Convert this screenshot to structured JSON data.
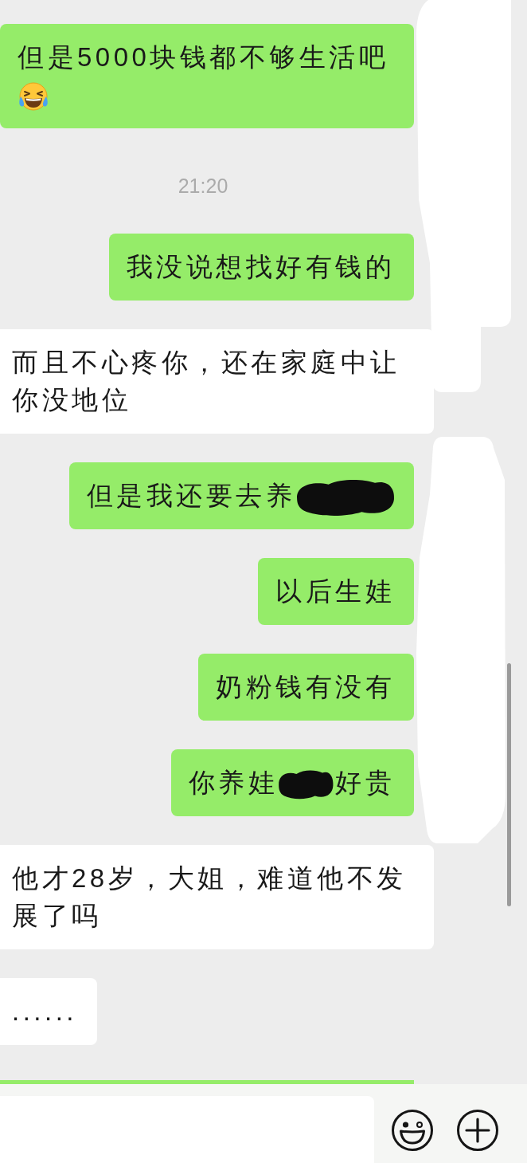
{
  "messages": [
    {
      "kind": "sent",
      "parts": [
        {
          "kind": "text",
          "text": "但是5000块钱都不够生活吧"
        },
        {
          "kind": "emoji"
        }
      ]
    },
    {
      "kind": "time",
      "text": "21:20"
    },
    {
      "kind": "sent",
      "parts": [
        {
          "kind": "text",
          "text": "我没说想找好有钱的"
        }
      ]
    },
    {
      "kind": "received",
      "parts": [
        {
          "kind": "text",
          "text": "而且不心疼你，还在家庭中让你没地位"
        }
      ]
    },
    {
      "kind": "sent",
      "parts": [
        {
          "kind": "text",
          "text": "但是我还要去养"
        },
        {
          "kind": "redaction"
        }
      ]
    },
    {
      "kind": "sent",
      "parts": [
        {
          "kind": "text",
          "text": "以后生娃"
        }
      ]
    },
    {
      "kind": "sent",
      "parts": [
        {
          "kind": "text",
          "text": "奶粉钱有没有"
        }
      ]
    },
    {
      "kind": "sent",
      "parts": [
        {
          "kind": "text",
          "text": "你养娃"
        },
        {
          "kind": "redaction"
        },
        {
          "kind": "text",
          "text": "好贵"
        }
      ]
    },
    {
      "kind": "received",
      "parts": [
        {
          "kind": "text",
          "text": "他才28岁，大姐，难道他不发展了吗"
        }
      ]
    },
    {
      "kind": "received",
      "parts": [
        {
          "kind": "text",
          "text": "......"
        }
      ]
    }
  ]
}
